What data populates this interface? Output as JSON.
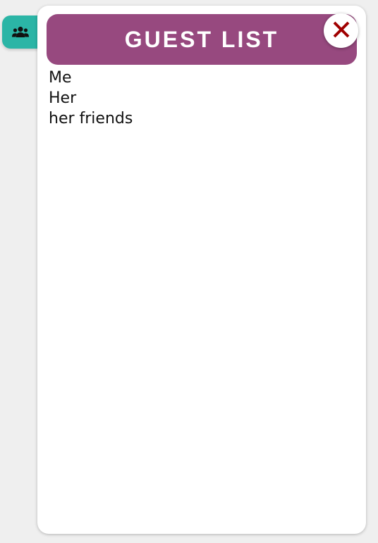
{
  "toggle": {
    "icon": "users-icon",
    "color": "#2bb5a6"
  },
  "panel": {
    "title": "GUEST LIST",
    "header_color": "#97497f",
    "close_icon": "close-icon",
    "close_color": "#a00000"
  },
  "guests": [
    {
      "name": "Me"
    },
    {
      "name": "Her"
    },
    {
      "name": "her friends"
    }
  ]
}
